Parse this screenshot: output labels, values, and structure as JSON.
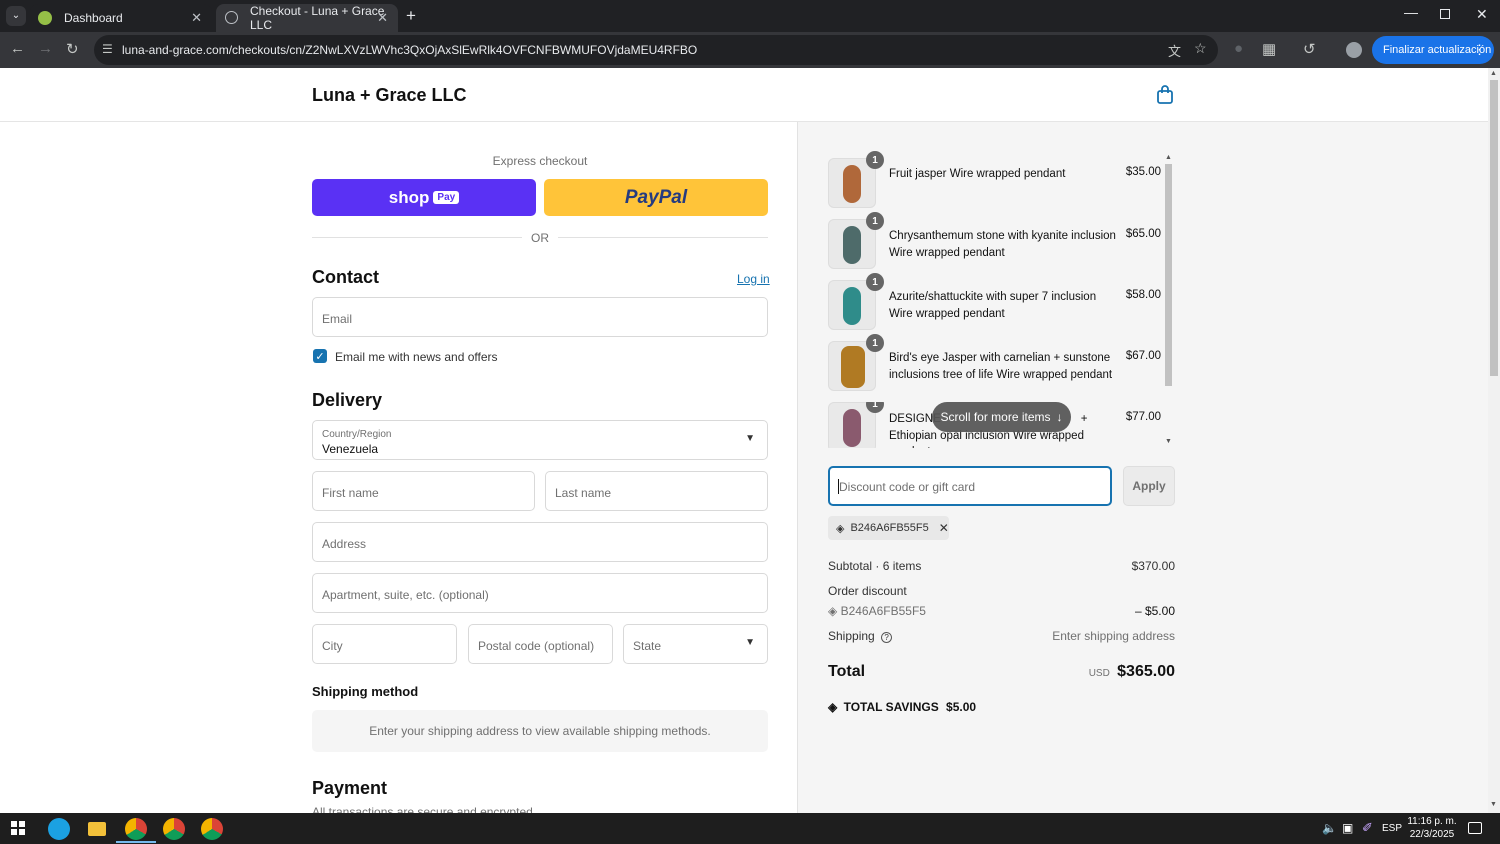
{
  "browser": {
    "tabs": [
      {
        "title": "Dashboard"
      },
      {
        "title": "Checkout - Luna + Grace LLC"
      }
    ],
    "url": "luna-and-grace.com/checkouts/cn/Z2NwLXVzLWVhc3QxOjAxSlEwRlk4OVFCNFBWMUFOVjdaMEU4RFBO",
    "update_label": "Finalizar actualización"
  },
  "store": {
    "name": "Luna + Grace LLC"
  },
  "express": {
    "label": "Express checkout",
    "shop_label": "shop",
    "shop_pay_badge": "Pay",
    "paypal_label": "PayPal",
    "or_label": "OR"
  },
  "contact": {
    "heading": "Contact",
    "login_label": "Log in",
    "email_placeholder": "Email",
    "newsletter_label": "Email me with news and offers"
  },
  "delivery": {
    "heading": "Delivery",
    "country_label": "Country/Region",
    "country_value": "Venezuela",
    "first_name_placeholder": "First name",
    "last_name_placeholder": "Last name",
    "address_placeholder": "Address",
    "apartment_placeholder": "Apartment, suite, etc. (optional)",
    "city_placeholder": "City",
    "postal_placeholder": "Postal code (optional)",
    "state_placeholder": "State"
  },
  "shipping_method": {
    "heading": "Shipping method",
    "info": "Enter your shipping address to view available shipping methods."
  },
  "payment": {
    "heading": "Payment",
    "subtext": "All transactions are secure and encrypted."
  },
  "order": {
    "items": [
      {
        "qty": "1",
        "name": "Fruit jasper Wire wrapped pendant",
        "price": "$35.00"
      },
      {
        "qty": "1",
        "name": "Chrysanthemum stone with kyanite inclusion Wire wrapped pendant",
        "price": "$65.00"
      },
      {
        "qty": "1",
        "name": "Azurite/shattuckite with super 7 inclusion Wire wrapped pendant",
        "price": "$58.00"
      },
      {
        "qty": "1",
        "name": "Bird's eye Jasper with carnelian + sunstone inclusions tree of life Wire wrapped pendant",
        "price": "$67.00"
      },
      {
        "qty": "1",
        "name": "DESIGNER ... + Ethiopian opal inclusion Wire wrapped pendant",
        "name_left": "DESIGNE",
        "name_right": "+",
        "name_line2": "Ethiopian opal inclusion Wire wrapped pendant",
        "price": "$77.00"
      }
    ],
    "scroll_hint": "Scroll for more items",
    "discount_placeholder": "Discount code or gift card",
    "apply_label": "Apply",
    "applied_code": "B246A6FB55F5",
    "subtotal_label": "Subtotal · 6 items",
    "subtotal_value": "$370.00",
    "order_discount_label": "Order discount",
    "discount_code": "B246A6FB55F5",
    "discount_value": "– $5.00",
    "shipping_label": "Shipping",
    "shipping_value": "Enter shipping address",
    "total_label": "Total",
    "currency": "USD",
    "total_value": "$365.00",
    "savings_label": "TOTAL SAVINGS",
    "savings_value": "$5.00"
  },
  "taskbar": {
    "lang": "ESP",
    "time": "11:16 p. m.",
    "date": "22/3/2025"
  },
  "colors": {
    "accent": "#1773b0",
    "shop_pay": "#5a31f4",
    "paypal": "#ffc439",
    "update": "#1a73e8"
  }
}
